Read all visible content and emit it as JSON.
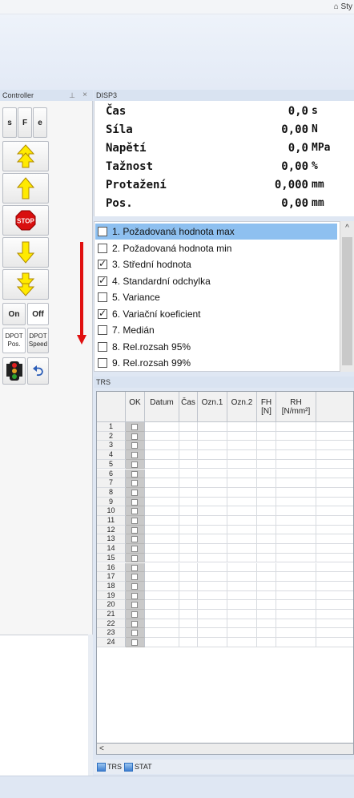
{
  "topbar": {
    "style_label": "⌂ Sty"
  },
  "controller": {
    "title": "Controller",
    "pin": "⊥",
    "close": "×",
    "buttons": {
      "s": "s",
      "f": "F",
      "e": "e",
      "stop": "STOP",
      "on": "On",
      "off": "Off",
      "dpot_pos": "DPOT Pos.",
      "dpot_speed": "DPOT Speed"
    }
  },
  "disp3": {
    "title": "DISP3",
    "rows": [
      {
        "label": "Čas",
        "value": "0,0",
        "unit": "s"
      },
      {
        "label": "Síla",
        "value": "0,00",
        "unit": "N"
      },
      {
        "label": "Napětí",
        "value": "0,0",
        "unit": "MPa"
      },
      {
        "label": "Tažnost",
        "value": "0,00",
        "unit": "%"
      },
      {
        "label": "Protažení",
        "value": "0,000",
        "unit": "mm"
      },
      {
        "label": "Pos.",
        "value": "0,00",
        "unit": "mm"
      }
    ]
  },
  "stats": {
    "items": [
      {
        "label": "1. Požadovaná hodnota max",
        "checked": false,
        "selected": true
      },
      {
        "label": "2. Požadovaná hodnota min",
        "checked": false,
        "selected": false
      },
      {
        "label": "3. Střední hodnota",
        "checked": true,
        "selected": false
      },
      {
        "label": "4. Standardní odchylka",
        "checked": true,
        "selected": false
      },
      {
        "label": "5. Variance",
        "checked": false,
        "selected": false
      },
      {
        "label": "6. Variační koeficient",
        "checked": true,
        "selected": false
      },
      {
        "label": "7. Medián",
        "checked": false,
        "selected": false
      },
      {
        "label": "8. Rel.rozsah 95%",
        "checked": false,
        "selected": false
      },
      {
        "label": "9. Rel.rozsah 99%",
        "checked": false,
        "selected": false
      }
    ],
    "scroll_up": "^"
  },
  "trs": {
    "title": "TRS",
    "columns": [
      "OK",
      "Datum",
      "Čas",
      "Ozn.1",
      "Ozn.2",
      "FH\n[N]",
      "RH\n[N/mm²]"
    ],
    "rows": [
      "1",
      "2",
      "3",
      "4",
      "5",
      "6",
      "7",
      "8",
      "9",
      "10",
      "11",
      "12",
      "13",
      "14",
      "15",
      "16",
      "17",
      "18",
      "19",
      "20",
      "21",
      "22",
      "23",
      "24"
    ],
    "hscroll_left": "<",
    "tabs": [
      "TRS",
      "STAT"
    ]
  }
}
